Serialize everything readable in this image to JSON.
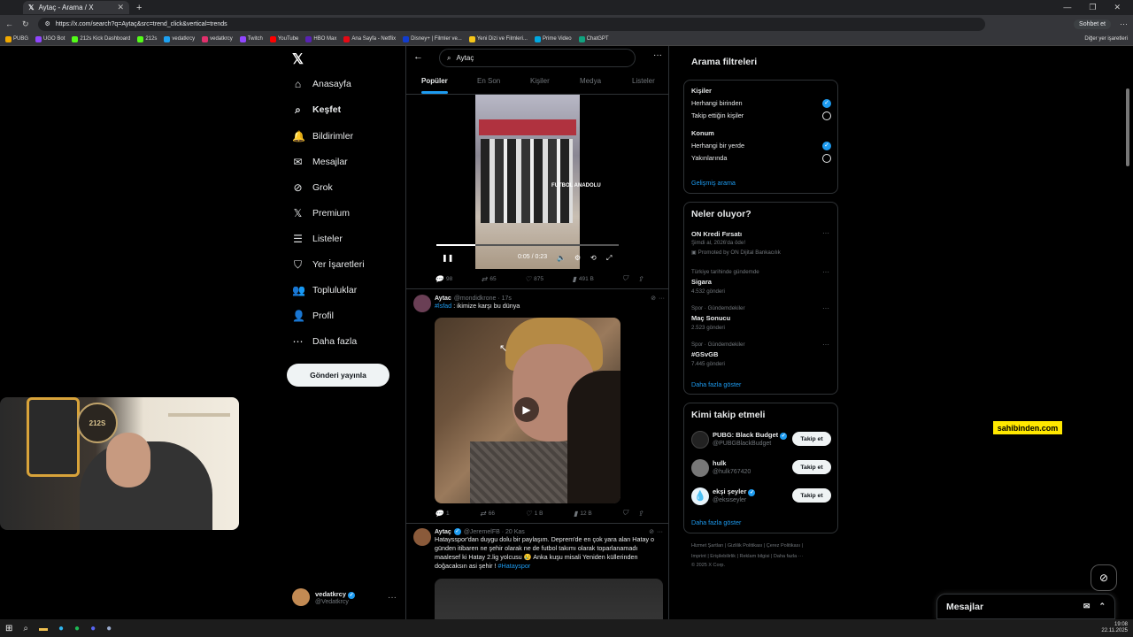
{
  "browser": {
    "tab_title": "Aytaç - Arama / X",
    "url": "https://x.com/search?q=Aytaç&src=trend_click&vertical=trends",
    "chat_button": "Sohbet et",
    "bookmarks": [
      "PUBG",
      "UGO Bot",
      "212s Kick Dashboard",
      "212s",
      "vedatkrcy",
      "vedatkrcy",
      "Twitch",
      "YouTube",
      "HBO Max",
      "Ana Sayfa - Netflix",
      "Disney+ | Filmler ve...",
      "Yeni Dizi ve Filmleri...",
      "Prime Video",
      "ChatGPT"
    ],
    "bookmarks_other": "Diğer yer işaretleri"
  },
  "nav": {
    "items": [
      {
        "label": "Anasayfa",
        "icon": "home-icon"
      },
      {
        "label": "Keşfet",
        "icon": "search-icon"
      },
      {
        "label": "Bildirimler",
        "icon": "bell-icon"
      },
      {
        "label": "Mesajlar",
        "icon": "mail-icon"
      },
      {
        "label": "Grok",
        "icon": "grok-icon"
      },
      {
        "label": "Premium",
        "icon": "x-icon"
      },
      {
        "label": "Listeler",
        "icon": "list-icon"
      },
      {
        "label": "Yer İşaretleri",
        "icon": "bookmark-icon"
      },
      {
        "label": "Topluluklar",
        "icon": "communities-icon"
      },
      {
        "label": "Profil",
        "icon": "profile-icon"
      },
      {
        "label": "Daha fazla",
        "icon": "more-icon"
      }
    ],
    "post_button": "Gönderi yayınla",
    "user_name": "vedatkrcy",
    "user_handle": "@Vedatkrcy"
  },
  "search": {
    "query": "Aytaç",
    "tabs": [
      "Popüler",
      "En Son",
      "Kişiler",
      "Medya",
      "Listeler"
    ]
  },
  "posts": [
    {
      "video_time": "0:05 / 0:23",
      "watermark": "FUTBOL ANADOLU",
      "replies": "98",
      "reposts": "65",
      "likes": "875",
      "views": "491 B"
    },
    {
      "name": "Aytac",
      "handle": "@mondidkrone · 17s",
      "hashtag": "#lsfad",
      "text": ": ikimize karşı bu dünya",
      "replies": "1",
      "reposts": "66",
      "likes": "1 B",
      "views": "12 B"
    },
    {
      "name": "Aytaç",
      "handle": "@JeremelFB · 20 Kas",
      "text": "Hataysspor'dan duygu dolu bir paylaşım. Deprem'de en çok yara alan Hatay o günden itibaren ne şehir olarak ne de futbol takımı olarak toparlanamadı maalesef ki Hatay 2.lig yolcusu 😢 Anka kuşu misali Yeniden küllerinden doğacaksın asi şehir !",
      "hashtag": "#Hatayspor"
    }
  ],
  "filters": {
    "title": "Arama filtreleri",
    "people_label": "Kişiler",
    "people_opts": [
      "Herhangi birinden",
      "Takip ettiğin kişiler"
    ],
    "loc_label": "Konum",
    "loc_opts": [
      "Herhangi bir yerde",
      "Yakınlarında"
    ],
    "advanced": "Gelişmiş arama"
  },
  "trends": {
    "title": "Neler oluyor?",
    "promo_title": "ON Kredi Fırsatı",
    "promo_sub": "Şimdi al, 2026'da öde!",
    "promo_by": "Promoted by ON Dijital Bankacılık",
    "items": [
      {
        "meta": "Türkiye tarihinde gündemde",
        "title": "Sigara",
        "count": "4.532 gönderi"
      },
      {
        "meta": "Spor · Gündemdekiler",
        "title": "Maç Sonucu",
        "count": "2.523 gönderi"
      },
      {
        "meta": "Spor · Gündemdekiler",
        "title": "#GSvGB",
        "count": "7.445 gönderi"
      }
    ],
    "more": "Daha fazla göster"
  },
  "who_to_follow": {
    "title": "Kimi takip etmeli",
    "items": [
      {
        "name": "PUBG: Black Budget",
        "handle": "@PUBGBlackBudget",
        "btn": "Takip et"
      },
      {
        "name": "hulk",
        "handle": "@hulk767420",
        "btn": "Takip et"
      },
      {
        "name": "ekşi şeyler",
        "handle": "@eksiseyler",
        "btn": "Takip et"
      }
    ],
    "more": "Daha fazla göster"
  },
  "footer": {
    "line1": "Hizmet Şartları  |  Gizlilik Politikası  |  Çerez Politikası  |",
    "line2": "Imprint  |  Erişilebilirlik  |  Reklam bilgisi  |  Daha fazla ···",
    "line3": "© 2025 X Corp."
  },
  "overlay": {
    "sahibinden": "sahibinden.com",
    "webcam_logo": "212S"
  },
  "messages_drawer": "Mesajlar",
  "taskbar": {
    "time": "19:08",
    "date": "22.11.2025"
  },
  "colors": {
    "accent": "#1d9bf0",
    "bg": "#000000",
    "border": "#2f3336",
    "muted": "#71767b"
  }
}
